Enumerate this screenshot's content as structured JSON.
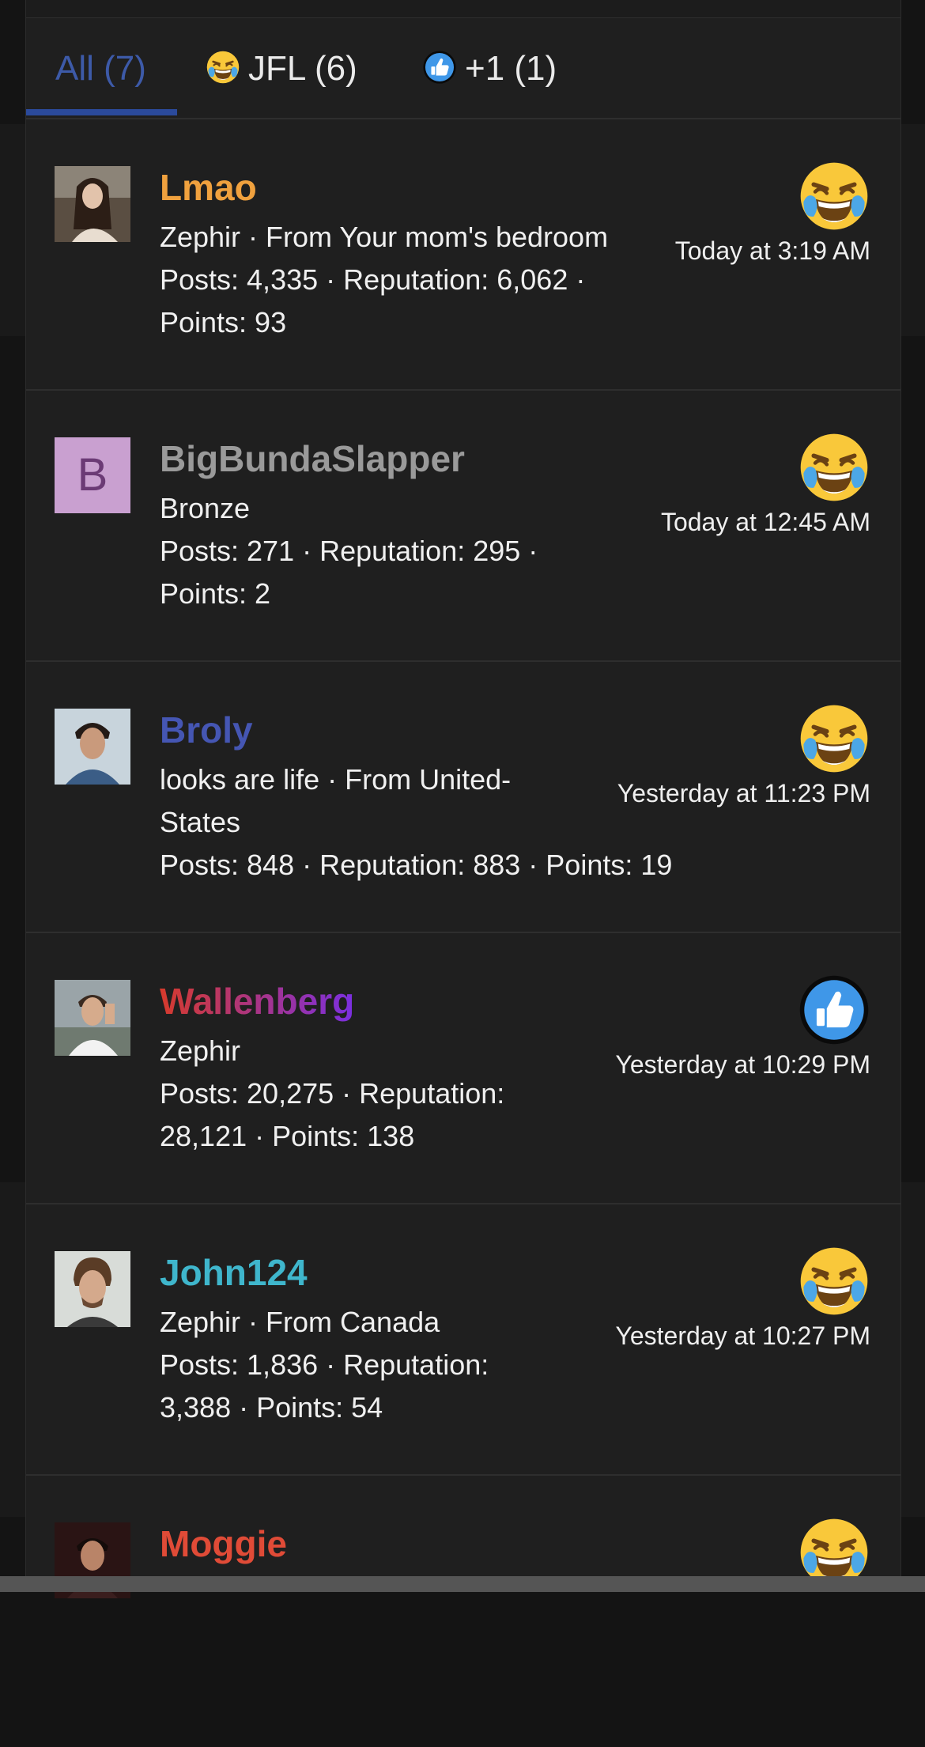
{
  "tabs": {
    "all_label": "All (7)",
    "jfl_label": "JFL (6)",
    "plus_one_label": "+1 (1)"
  },
  "users": [
    {
      "name": "Lmao",
      "name_color": "#f0a13e",
      "meta_line1": "Zephir · From Your mom's bedroom",
      "meta_line2": "Posts: 4,335 · Reputation: 6,062 ·",
      "meta_line3": "Points: 93",
      "time": "Today at 3:19 AM",
      "reaction_icon": "jfl-emoji-icon"
    },
    {
      "name": "BigBundaSlapper",
      "name_color": "#9a9a9a",
      "avatar_letter": "B",
      "meta_line1": "Bronze",
      "meta_line2": "Posts: 271 · Reputation: 295 ·",
      "meta_line3": "Points: 2",
      "time": "Today at 12:45 AM",
      "reaction_icon": "jfl-emoji-icon"
    },
    {
      "name": "Broly",
      "name_color": "#4556b3",
      "meta_line1": "looks are life · From United-",
      "meta_line2": "States",
      "meta_line3": "Posts: 848 · Reputation: 883 · Points: 19",
      "time": "Yesterday at 11:23 PM",
      "reaction_icon": "jfl-emoji-icon"
    },
    {
      "name": "Wallenberg",
      "name_color": "gradient-red-purple",
      "meta_line1": "Zephir",
      "meta_line2": "Posts: 20,275 · Reputation:",
      "meta_line3": "28,121 · Points: 138",
      "time": "Yesterday at 10:29 PM",
      "reaction_icon": "thumbs-up-icon"
    },
    {
      "name": "John124",
      "name_color": "#3fb6cc",
      "meta_line1": "Zephir · From Canada",
      "meta_line2": "Posts: 1,836 · Reputation:",
      "meta_line3": "3,388 · Points: 54",
      "time": "Yesterday at 10:27 PM",
      "reaction_icon": "jfl-emoji-icon"
    },
    {
      "name": "Moggie",
      "name_color": "#e04b37",
      "reaction_icon": "jfl-emoji-icon"
    }
  ]
}
